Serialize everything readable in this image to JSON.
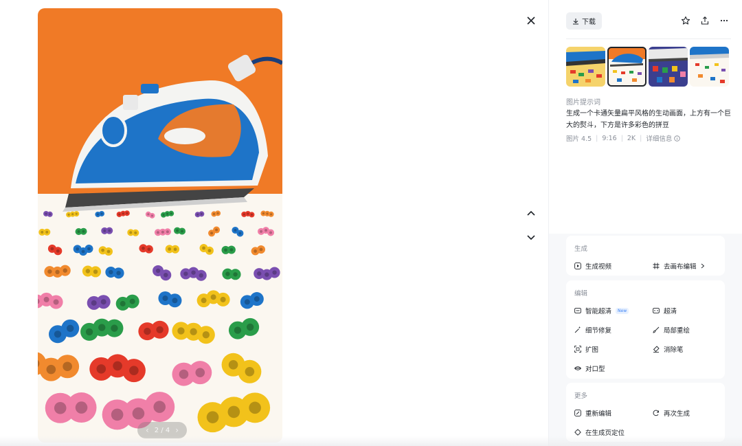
{
  "page": {
    "close_icon": "close-icon"
  },
  "viewer": {
    "pager_text": "2 / 4",
    "nav_up_icon": "chevron-up-icon",
    "nav_down_icon": "chevron-down-icon"
  },
  "toolbar": {
    "download_label": "下载",
    "icons": [
      "star-icon",
      "share-icon",
      "more-icon"
    ]
  },
  "thumbnails": {
    "count": 4,
    "selected_index": 1
  },
  "prompt": {
    "label": "图片提示词",
    "text": "生成一个卡通矢量扁平风格的生动画面，上方有一个巨大的熨斗，下方是许多彩色的拼豆",
    "meta": {
      "model": "图片 4.5",
      "ratio": "9:16",
      "resolution": "2K",
      "details": "详细信息"
    }
  },
  "sections": {
    "generate": {
      "title": "生成",
      "items": [
        {
          "label": "生成视频",
          "icon": "play-square-icon"
        },
        {
          "label": "去画布编辑",
          "icon": "canvas-grid-icon"
        }
      ]
    },
    "edit": {
      "title": "编辑",
      "badge": "New",
      "items": [
        {
          "label": "智能超清",
          "icon": "smart-hd-icon"
        },
        {
          "label": "超清",
          "icon": "hd-icon"
        },
        {
          "label": "细节修复",
          "icon": "magic-wand-icon"
        },
        {
          "label": "局部重绘",
          "icon": "brush-icon"
        },
        {
          "label": "扩图",
          "icon": "expand-icon"
        },
        {
          "label": "消除笔",
          "icon": "eraser-icon"
        },
        {
          "label": "对口型",
          "icon": "lips-icon"
        }
      ]
    },
    "more": {
      "title": "更多",
      "items": [
        {
          "label": "重新编辑",
          "icon": "re-edit-icon"
        },
        {
          "label": "再次生成",
          "icon": "regenerate-icon"
        },
        {
          "label": "在生成页定位",
          "icon": "locate-icon"
        }
      ]
    }
  },
  "colors": {
    "background_orange": "#f07a26",
    "iron_blue": "#1e74c8",
    "beads": [
      "#f2c21b",
      "#e53a2a",
      "#2a9d4a",
      "#7a4fb0",
      "#1e74c8",
      "#f18a2e",
      "#f07fa8"
    ]
  }
}
